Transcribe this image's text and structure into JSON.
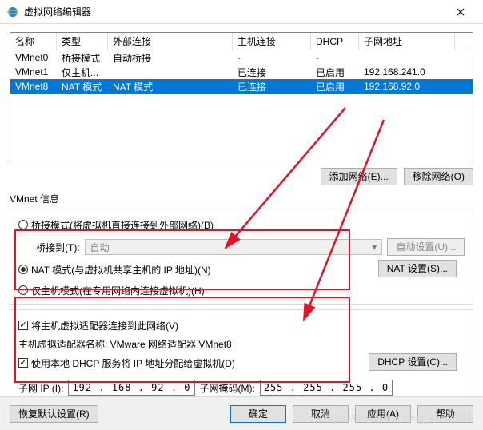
{
  "title": "虚拟网络编辑器",
  "table": {
    "headers": {
      "name": "名称",
      "type": "类型",
      "ext": "外部连接",
      "host": "主机连接",
      "dhcp": "DHCP",
      "subnet": "子网地址"
    },
    "rows": [
      {
        "name": "VMnet0",
        "type": "桥接模式",
        "ext": "自动桥接",
        "host": "-",
        "dhcp": "-",
        "subnet": ""
      },
      {
        "name": "VMnet1",
        "type": "仅主机...",
        "ext": "",
        "host": "已连接",
        "dhcp": "已启用",
        "subnet": "192.168.241.0"
      },
      {
        "name": "VMnet8",
        "type": "NAT 模式",
        "ext": "NAT 模式",
        "host": "已连接",
        "dhcp": "已启用",
        "subnet": "192.168.92.0"
      }
    ]
  },
  "buttons": {
    "add_net": "添加网络(E)...",
    "remove_net": "移除网络(O)",
    "auto_set": "自动设置(U)...",
    "nat_set": "NAT 设置(S)...",
    "dhcp_set": "DHCP 设置(C)...",
    "restore": "恢复默认设置(R)",
    "ok": "确定",
    "cancel": "取消",
    "apply": "应用(A)",
    "help": "帮助"
  },
  "vmnet_info": {
    "group_label": "VMnet 信息",
    "bridge_radio": "桥接模式(将虚拟机直接连接到外部网络)(B)",
    "bridge_to_label": "桥接到(T):",
    "bridge_to_value": "自动",
    "nat_radio": "NAT 模式(与虚拟机共享主机的 IP 地址)(N)",
    "hostonly_radio": "仅主机模式(在专用网络内连接虚拟机)(H)"
  },
  "adapter": {
    "connect_check": "将主机虚拟适配器连接到此网络(V)",
    "adapter_name_label": "主机虚拟适配器名称: VMware 网络适配器 VMnet8",
    "dhcp_check": "使用本地 DHCP 服务将 IP 地址分配给虚拟机(D)",
    "subnet_ip_label": "子网 IP (I):",
    "subnet_ip": "192 . 168 . 92 . 0",
    "mask_label": "子网掩码(M):",
    "mask": "255 . 255 . 255 . 0"
  },
  "watermark": "https://blog.csdn.net/qq_41741884"
}
